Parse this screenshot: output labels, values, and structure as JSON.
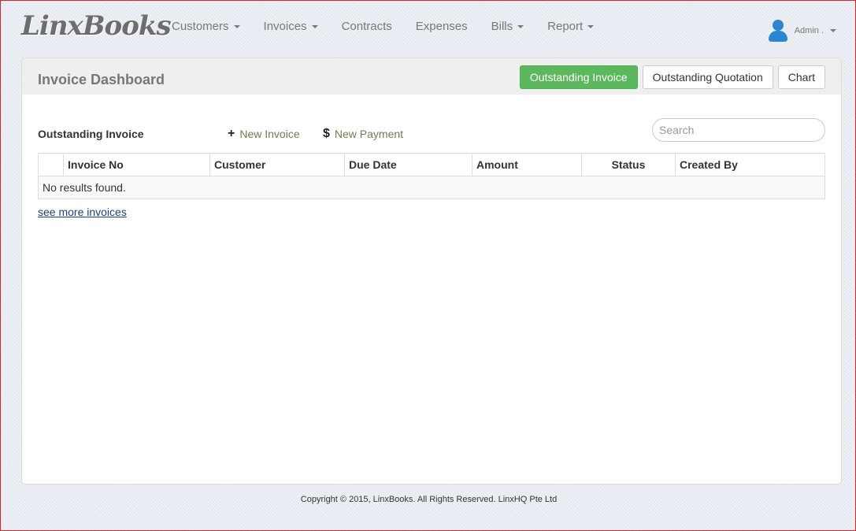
{
  "brand": "LinxBooks",
  "nav": {
    "customers": "Customers",
    "invoices": "Invoices",
    "contracts": "Contracts",
    "expenses": "Expenses",
    "bills": "Bills",
    "report": "Report"
  },
  "user": {
    "name": "Admin ."
  },
  "panel": {
    "title": "Invoice Dashboard",
    "buttons": {
      "outstanding_invoice": "Outstanding Invoice",
      "outstanding_quotation": "Outstanding Quotation",
      "chart": "Chart"
    }
  },
  "section": {
    "title": "Outstanding Invoice",
    "new_invoice": "New Invoice",
    "new_payment": "New Payment",
    "search_placeholder": "Search"
  },
  "table": {
    "columns": [
      "",
      "Invoice No",
      "Customer",
      "Due Date",
      "Amount",
      "Status",
      "Created By"
    ],
    "empty": "No results found."
  },
  "see_more": "see more invoices",
  "footer": "Copyright © 2015, LinxBooks. All Rights Reserved. LinxHQ Pte Ltd",
  "colors": {
    "success": "#5cb85c",
    "user_icon": "#2b86d1",
    "link": "#1f3e7c"
  }
}
